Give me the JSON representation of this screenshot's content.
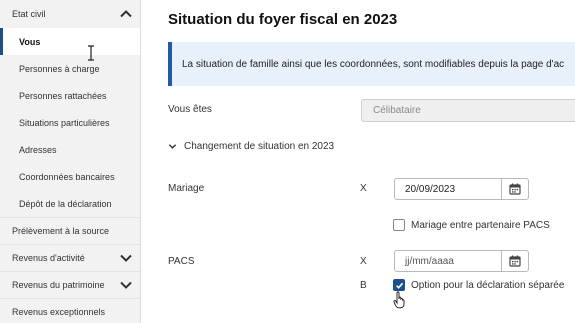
{
  "sidebar": {
    "items": [
      {
        "label": "Etat civil",
        "type": "section",
        "chevron": "up"
      },
      {
        "label": "Vous",
        "type": "sub",
        "active": true
      },
      {
        "label": "Personnes à charge",
        "type": "sub"
      },
      {
        "label": "Personnes rattachées",
        "type": "sub"
      },
      {
        "label": "Situations particulières",
        "type": "sub"
      },
      {
        "label": "Adresses",
        "type": "sub"
      },
      {
        "label": "Coordonnées bancaires",
        "type": "sub"
      },
      {
        "label": "Dépôt de la déclaration",
        "type": "sub"
      },
      {
        "label": "Prélèvement à la source",
        "type": "section"
      },
      {
        "label": "Revenus d'activité",
        "type": "section",
        "chevron": "down"
      },
      {
        "label": "Revenus du patrimoine",
        "type": "section",
        "chevron": "down"
      },
      {
        "label": "Revenus exceptionnels",
        "type": "section"
      }
    ]
  },
  "main": {
    "title": "Situation du foyer fiscal en 2023",
    "info_text": "La situation de famille ainsi que les coordonnées, sont modifiables depuis la page d'ac",
    "vous_etes": {
      "label": "Vous êtes",
      "value": "Célibataire"
    },
    "changement": {
      "label": "Changement de situation en 2023"
    },
    "mariage": {
      "label": "Mariage",
      "box": "X",
      "date": "20/09/2023",
      "partner_label": "Mariage entre partenaire PACS",
      "partner_checked": false
    },
    "pacs": {
      "label": "PACS",
      "box": "X",
      "date_placeholder": "jj/mm/aaaa",
      "option_box": "B",
      "option_label": "Option pour la déclaration séparée",
      "option_checked": true
    }
  },
  "colors": {
    "accent": "#1c4f8c",
    "info_bg": "#e8f0fb",
    "info_border": "#1f5aa6",
    "sidebar_bg": "#f2f2f2"
  }
}
